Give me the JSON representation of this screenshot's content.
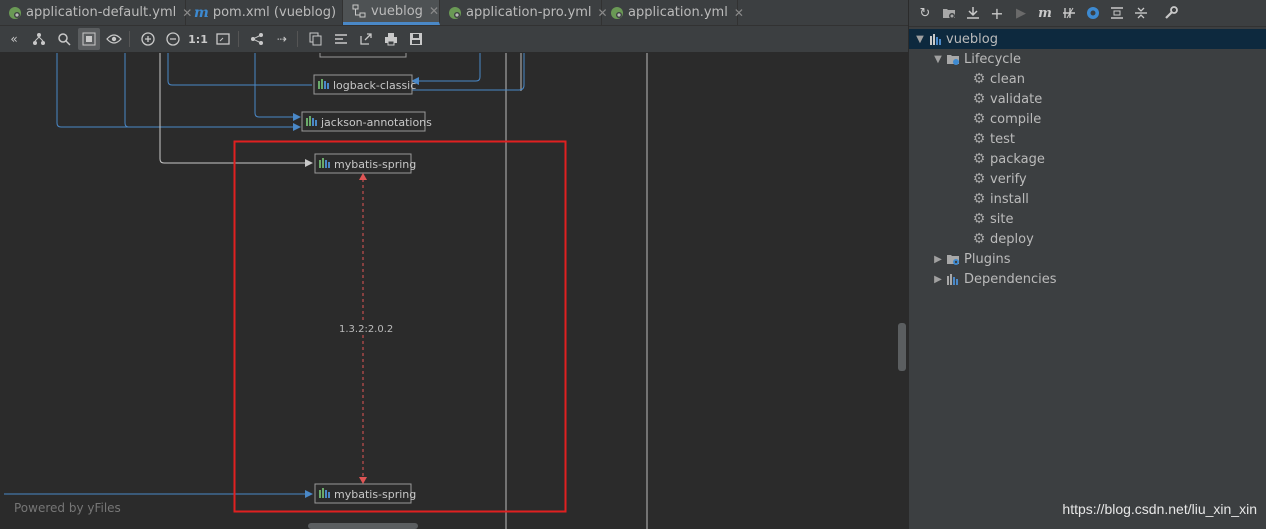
{
  "tabs": [
    {
      "label": "application-default.yml",
      "icon": "spring-leaf-icon",
      "close": "✕"
    },
    {
      "label": "pom.xml (vueblog)",
      "icon": "maven-m-icon",
      "close": "✕"
    },
    {
      "label": "vueblog",
      "icon": "diagram-icon",
      "close": "✕"
    },
    {
      "label": "application-pro.yml",
      "icon": "spring-leaf-icon",
      "close": "✕"
    },
    {
      "label": "application.yml",
      "icon": "spring-leaf-icon",
      "close": "✕"
    }
  ],
  "toolbar": {
    "one_to_one": "1:1"
  },
  "diagram": {
    "nodes": [
      {
        "label": "logback-classic"
      },
      {
        "label": "jackson-annotations"
      },
      {
        "label": "mybatis-spring"
      },
      {
        "label": "mybatis-spring"
      }
    ],
    "conflict_label": "1.3.2:2.0.2",
    "watermark": "Powered by yFiles",
    "highlight_color": "#e02020",
    "edge_color": "#4a88c7",
    "conflict_color": "#e05555"
  },
  "maven_panel": {
    "project": "vueblog",
    "lifecycle_label": "Lifecycle",
    "goals": [
      "clean",
      "validate",
      "compile",
      "test",
      "package",
      "verify",
      "install",
      "site",
      "deploy"
    ],
    "plugins_label": "Plugins",
    "dependencies_label": "Dependencies"
  },
  "caption": "https://blog.csdn.net/liu_xin_xin"
}
